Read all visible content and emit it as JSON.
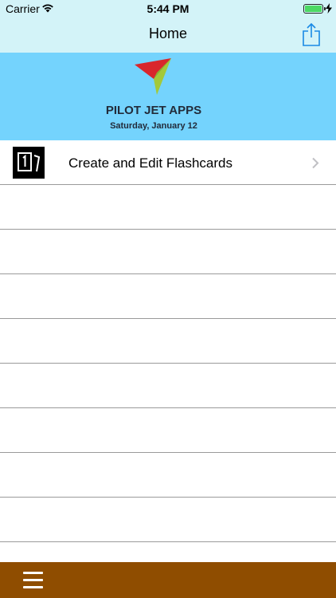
{
  "status_bar": {
    "carrier": "Carrier",
    "time": "5:44 PM",
    "battery_color": "#4cd964"
  },
  "nav": {
    "title": "Home",
    "share_icon": "share-icon"
  },
  "banner": {
    "app_name": "PILOT JET APPS",
    "date": "Saturday, January 12",
    "background": "#74d3fd"
  },
  "list": {
    "items": [
      {
        "label": "Create and Edit Flashcards",
        "icon": "flashcards-icon"
      }
    ],
    "empty_rows": 8
  },
  "bottom_bar": {
    "background": "#8f4d00",
    "menu_icon": "hamburger-menu-icon"
  }
}
